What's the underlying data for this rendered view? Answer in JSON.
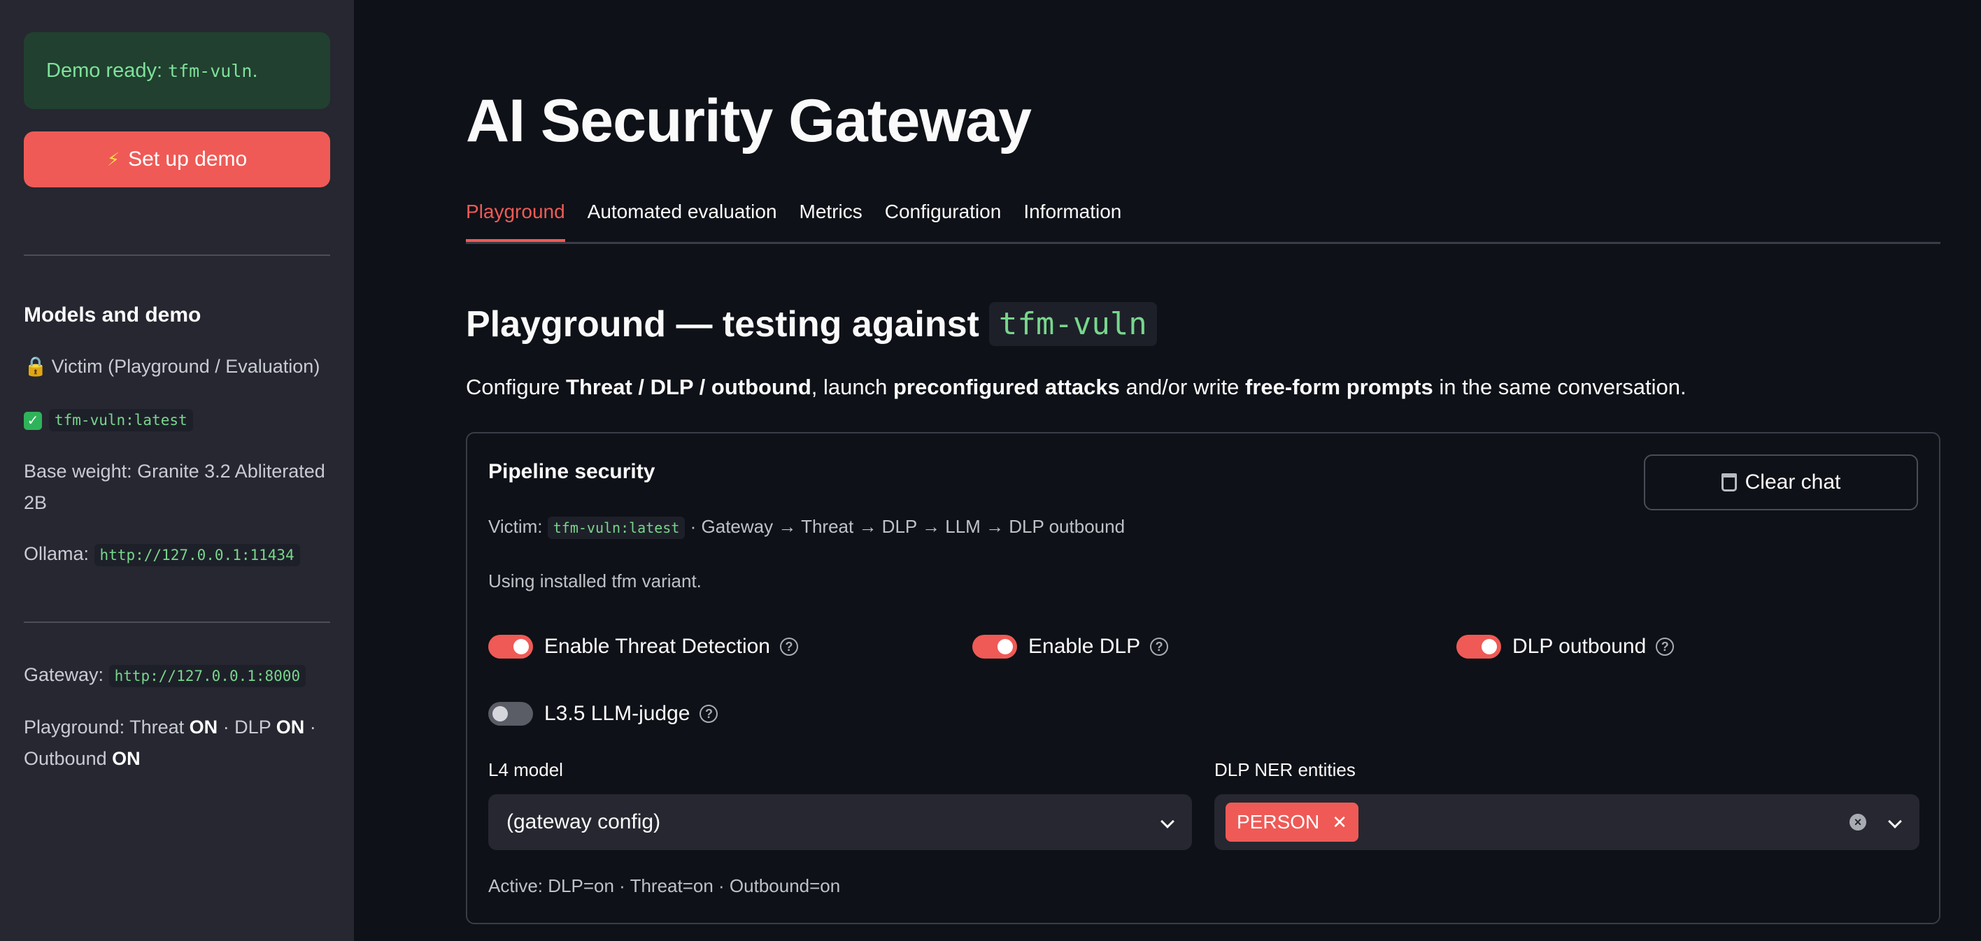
{
  "sidebar": {
    "alert_text": "Demo ready:",
    "alert_code": "tfm-vuln",
    "alert_suffix": ".",
    "setup_button": "Set up demo",
    "section_title": "Models and demo",
    "victim_label": "Victim (Playground / Evaluation)",
    "victim_model": "tfm-vuln:latest",
    "base_weight_label": "Base weight: Granite 3.2 Abliterated 2B",
    "ollama_label": "Ollama:",
    "ollama_url": "http://127.0.0.1:11434",
    "gateway_label": "Gateway:",
    "gateway_url": "http://127.0.0.1:8000",
    "status_prefix": "Playground: Threat",
    "status_threat": "ON",
    "status_dlp_label": "· DLP",
    "status_dlp": "ON",
    "status_sep": "·",
    "status_outbound_label": "Outbound",
    "status_outbound": "ON"
  },
  "app": {
    "title": "AI Security Gateway"
  },
  "tabs": [
    {
      "label": "Playground",
      "active": true
    },
    {
      "label": "Automated evaluation",
      "active": false
    },
    {
      "label": "Metrics",
      "active": false
    },
    {
      "label": "Configuration",
      "active": false
    },
    {
      "label": "Information",
      "active": false
    }
  ],
  "playground": {
    "title": "Playground — testing against",
    "title_code": "tfm-vuln",
    "intro": {
      "t1": "Configure ",
      "b1": "Threat / DLP / outbound",
      "t2": ", launch ",
      "b2": "preconfigured attacks",
      "t3": " and/or write ",
      "b3": "free-form prompts",
      "t4": " in the same conversation."
    },
    "card": {
      "heading": "Pipeline security",
      "clear_button": "Clear chat",
      "victim_label": "Victim:",
      "victim_code": "tfm-vuln:latest",
      "pipeline": "· Gateway → Threat → DLP → LLM → DLP outbound",
      "using_text": "Using installed tfm variant.",
      "toggles": {
        "threat": {
          "label": "Enable Threat Detection",
          "on": true
        },
        "dlp": {
          "label": "Enable DLP",
          "on": true
        },
        "outbound": {
          "label": "DLP outbound",
          "on": true
        },
        "judge": {
          "label": "L3.5 LLM-judge",
          "on": false
        }
      },
      "l4_label": "L4 model",
      "l4_value": "(gateway config)",
      "ner_label": "DLP NER entities",
      "ner_chip": "PERSON",
      "active_line": "Active: DLP=on · Threat=on · Outbound=on"
    }
  },
  "colors": {
    "accent": "#ef5a56",
    "background": "#0e1117",
    "sidebar": "#262730",
    "success_text": "#7ee19a"
  }
}
